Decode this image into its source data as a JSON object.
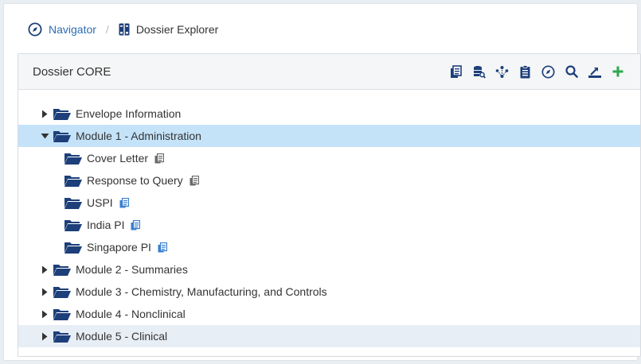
{
  "breadcrumb": {
    "navigator_label": "Navigator",
    "separator": "/",
    "current_label": "Dossier Explorer"
  },
  "panel": {
    "title": "Dossier CORE"
  },
  "toolbar": {
    "icons": [
      "documents-icon",
      "database-search-icon",
      "hierarchy-icon",
      "clipboard-icon",
      "compass-icon",
      "search-icon",
      "export-icon",
      "add-icon"
    ]
  },
  "tree": {
    "items": [
      {
        "label": "Envelope Information",
        "expanded": false
      },
      {
        "label": "Module 1 - Administration",
        "expanded": true
      },
      {
        "label": "Cover Letter"
      },
      {
        "label": "Response to Query"
      },
      {
        "label": "USPI"
      },
      {
        "label": "India PI"
      },
      {
        "label": "Singapore PI"
      },
      {
        "label": "Module 2 - Summaries",
        "expanded": false
      },
      {
        "label": "Module 3 - Chemistry, Manufacturing, and Controls",
        "expanded": false
      },
      {
        "label": "Module 4 - Nonclinical",
        "expanded": false
      },
      {
        "label": "Module 5 - Clinical",
        "expanded": false
      }
    ]
  },
  "colors": {
    "link": "#2c6db3",
    "folder": "#1d3f7a",
    "selected_row": "#c4e3f9",
    "hover_row": "#e8eef6",
    "add_green": "#2fa84f",
    "doc_gray": "#6b6b6b",
    "doc_blue": "#3a7fd0"
  }
}
